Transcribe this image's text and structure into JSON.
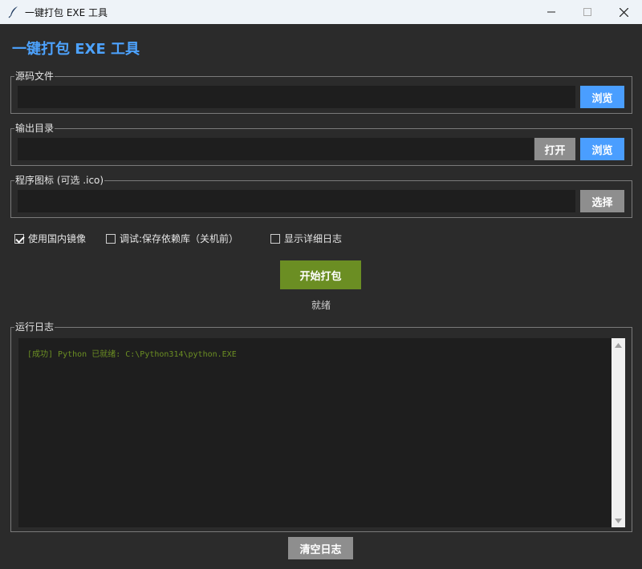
{
  "window": {
    "title": "一键打包 EXE 工具",
    "icons": [
      "feather-icon",
      "minimize-icon",
      "maximize-icon",
      "close-icon"
    ]
  },
  "heading": "一键打包 EXE 工具",
  "source_file": {
    "label": "源码文件",
    "value": "",
    "browse_label": "浏览"
  },
  "output_dir": {
    "label": "输出目录",
    "value": "",
    "open_label": "打开",
    "browse_label": "浏览"
  },
  "program_icon": {
    "label": "程序图标 (可选 .ico)",
    "value": "",
    "select_label": "选择"
  },
  "options": [
    {
      "label": "使用国内镜像",
      "checked": true
    },
    {
      "label": "调试:保存依赖库（关机前）",
      "checked": false
    },
    {
      "label": "显示详细日志",
      "checked": false
    }
  ],
  "start_button": "开始打包",
  "status": "就绪",
  "log": {
    "label": "运行日志",
    "lines": [
      "[成功] Python 已就绪: C:\\Python314\\python.EXE"
    ]
  },
  "clear_log_button": "清空日志",
  "colors": {
    "accent_blue": "#4a9eff",
    "heading_blue": "#4da3ff",
    "start_green": "#6b8e23",
    "log_success": "#6b8e23",
    "background": "#2b2b2b",
    "field": "#1e1e1e",
    "gray_button": "#8e8e8e"
  }
}
